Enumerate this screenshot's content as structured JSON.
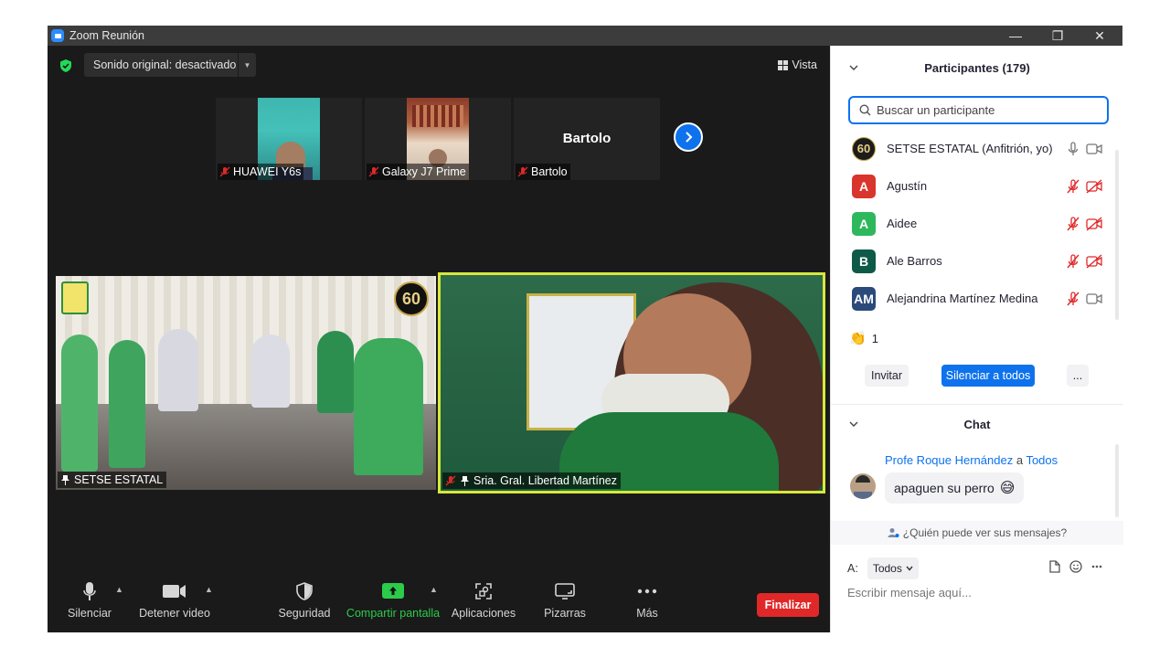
{
  "window": {
    "title": "Zoom Reunión",
    "controls": {
      "minimize": "—",
      "restore": "❐",
      "close": "✕"
    }
  },
  "meeting": {
    "audio_label": "Sonido original: desactivado",
    "view_label": "Vista",
    "thumbnails": [
      {
        "name": "HUAWEI Y6s",
        "muted": true,
        "kind": "video"
      },
      {
        "name": "Galaxy J7 Prime",
        "muted": true,
        "kind": "video"
      },
      {
        "name": "Bartolo",
        "muted": true,
        "kind": "name",
        "display_name": "Bartolo"
      }
    ],
    "tiles": [
      {
        "name": "SETSE ESTATAL",
        "pinned": true,
        "muted": false,
        "badge": "60"
      },
      {
        "name": "Sria. Gral. Libertad Martínez",
        "pinned": true,
        "muted": true,
        "active_speaker": true
      }
    ],
    "toolbar": {
      "mute": "Silenciar",
      "stop_video": "Detener video",
      "security": "Seguridad",
      "share": "Compartir pantalla",
      "apps": "Aplicaciones",
      "whiteboards": "Pizarras",
      "more": "Más",
      "end": "Finalizar"
    }
  },
  "participants": {
    "header": "Participantes (179)",
    "search_placeholder": "Buscar un participante",
    "list": [
      {
        "initials": "60",
        "name": "SETSE ESTATAL (Anfitrión, yo)",
        "color": "#1c1c1c",
        "mic_muted": false,
        "cam_off": false
      },
      {
        "initials": "A",
        "name": "Agustín",
        "color": "#d9352c",
        "mic_muted": true,
        "cam_off": true
      },
      {
        "initials": "A",
        "name": "Aidee",
        "color": "#2eb85c",
        "mic_muted": true,
        "cam_off": true
      },
      {
        "initials": "B",
        "name": "Ale Barros",
        "color": "#0e5a48",
        "mic_muted": true,
        "cam_off": true
      },
      {
        "initials": "AM",
        "name": "Alejandrina Martínez Medina",
        "color": "#2a4a7a",
        "mic_muted": true,
        "cam_off": false
      }
    ],
    "reaction_count": "1",
    "invite": "Invitar",
    "mute_all": "Silenciar a todos",
    "more": "..."
  },
  "chat": {
    "header": "Chat",
    "sender": "Profe Roque Hernández",
    "to_word": "a",
    "recipient": "Todos",
    "message": "apaguen su perro",
    "who_can_see": "¿Quién puede ver sus mensajes?",
    "to_label": "A:",
    "to_value": "Todos",
    "input_placeholder": "Escribir mensaje aquí..."
  },
  "colors": {
    "accent": "#0e72ed",
    "end": "#e02828",
    "share_green": "#2ccb4a",
    "speaker_border": "#d7e83c"
  }
}
